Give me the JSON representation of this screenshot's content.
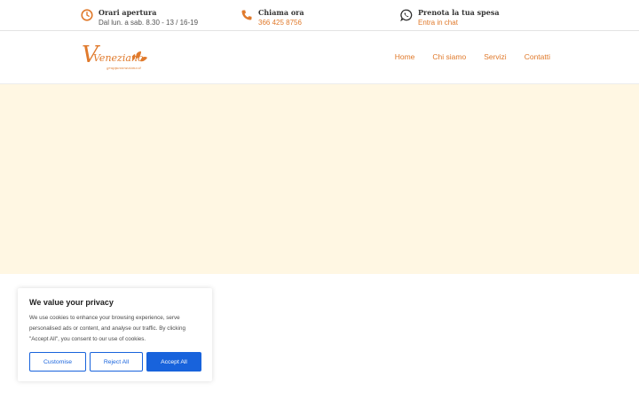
{
  "topbar": {
    "hours": {
      "title": "Orari apertura",
      "detail": "Dal lun. a sab. 8.30 - 13 / 16-19",
      "icon": "clock-icon"
    },
    "phone": {
      "title": "Chiama ora",
      "detail": "366 425 8756",
      "icon": "phone-icon"
    },
    "chat": {
      "title": "Prenota la tua spesa",
      "detail": "Entra in chat",
      "icon": "whatsapp-icon"
    }
  },
  "header": {
    "logo_text": "Veneziano",
    "logo_subtext": "gruppoveneziano.it",
    "nav": [
      "Home",
      "Chi siamo",
      "Servizi",
      "Contatti"
    ]
  },
  "cookie": {
    "title": "We value your privacy",
    "body": "We use cookies to enhance your browsing experience, serve personalised ads or content, and analyse our traffic. By clicking \"Accept All\", you consent to our use of cookies.",
    "customise": "Customise",
    "reject": "Reject All",
    "accept": "Accept All"
  },
  "colors": {
    "accent": "#e07a2c",
    "hero_bg": "#fff7e3",
    "button_blue": "#1863dc"
  }
}
